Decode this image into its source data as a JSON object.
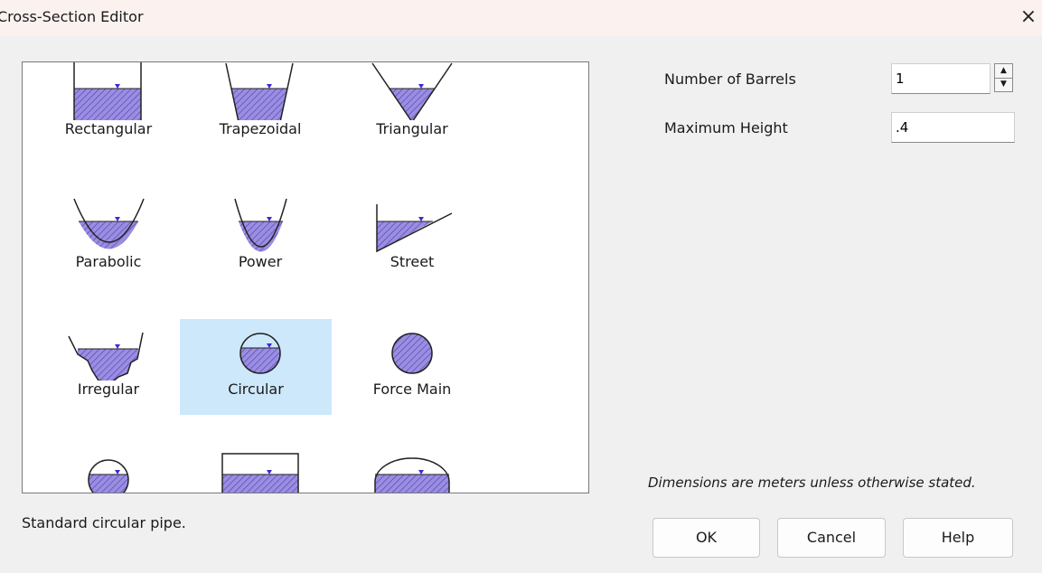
{
  "window": {
    "title": "Cross-Section Editor",
    "close_icon": "×"
  },
  "colors": {
    "water": "#9a8ee0",
    "hatch": "#5540b8",
    "marker": "#3a2bd6",
    "selected_bg": "#cde8fb"
  },
  "shapes": [
    {
      "label": "Rectangular",
      "icon": "rectangular-icon"
    },
    {
      "label": "Trapezoidal",
      "icon": "trapezoidal-icon"
    },
    {
      "label": "Triangular",
      "icon": "triangular-icon"
    },
    {
      "label": "Parabolic",
      "icon": "parabolic-icon"
    },
    {
      "label": "Power",
      "icon": "power-icon"
    },
    {
      "label": "Street",
      "icon": "street-icon"
    },
    {
      "label": "Irregular",
      "icon": "irregular-icon"
    },
    {
      "label": "Circular",
      "icon": "circular-icon",
      "selected": true
    },
    {
      "label": "Force Main",
      "icon": "force-main-icon"
    },
    {
      "label": "",
      "icon": "filled-circular-icon"
    },
    {
      "label": "",
      "icon": "rect-closed-icon"
    },
    {
      "label": "",
      "icon": "horizontal-ellipse-icon"
    }
  ],
  "properties": {
    "barrels_label": "Number of Barrels",
    "barrels_value": "1",
    "height_label": "Maximum Height",
    "height_value": ".4"
  },
  "units_note": "Dimensions are meters unless otherwise stated.",
  "status_text": "Standard circular pipe.",
  "buttons": {
    "ok": "OK",
    "cancel": "Cancel",
    "help": "Help"
  }
}
